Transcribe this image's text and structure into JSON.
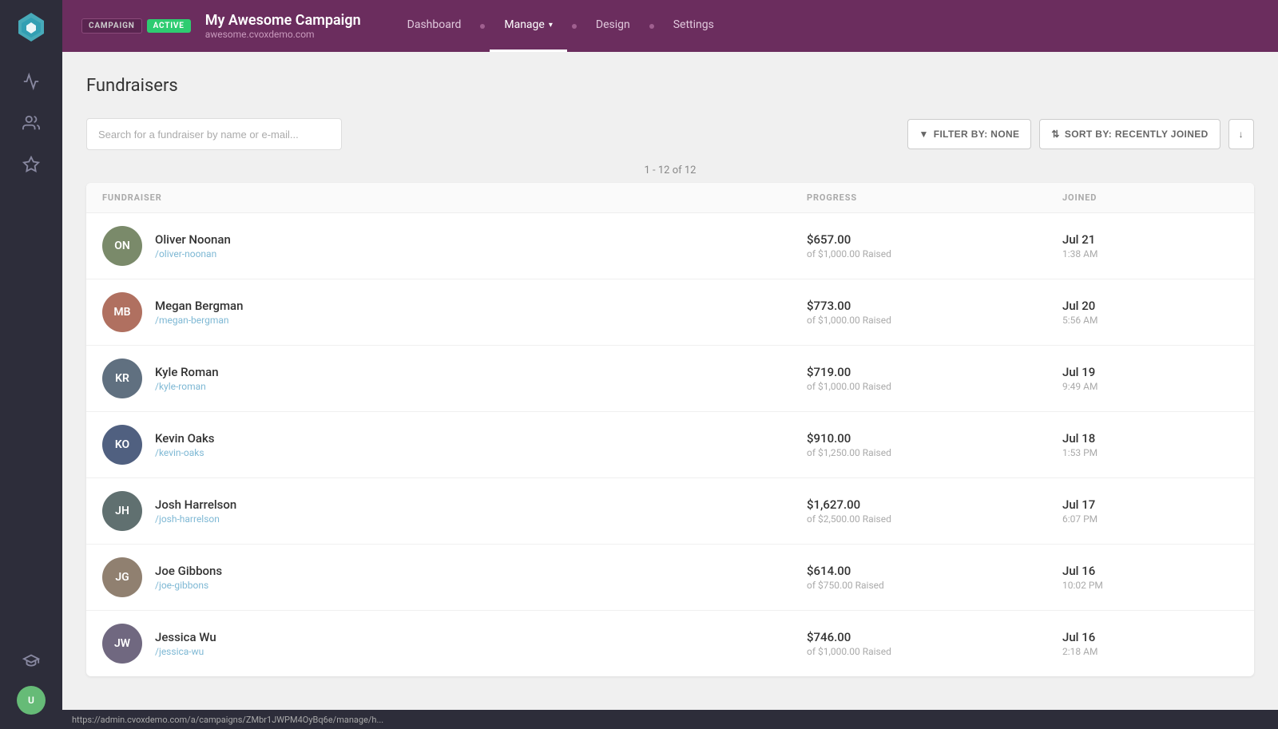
{
  "sidebar": {
    "logo_alt": "Sendoso logo"
  },
  "topbar": {
    "campaign_label": "CAMPAIGN",
    "active_label": "ACTIVE",
    "campaign_name": "My Awesome Campaign",
    "campaign_url": "awesome.cvoxdemo.com",
    "nav": [
      {
        "label": "Dashboard",
        "active": false
      },
      {
        "label": "Manage",
        "active": true,
        "has_chevron": true
      },
      {
        "label": "Design",
        "active": false
      },
      {
        "label": "Settings",
        "active": false
      }
    ]
  },
  "page": {
    "title": "Fundraisers",
    "search_placeholder": "Search for a fundraiser by name or e-mail...",
    "filter_label": "FILTER BY: NONE",
    "sort_label": "SORT BY: RECENTLY JOINED",
    "pagination": "1 - 12 of 12",
    "columns": {
      "fundraiser": "FUNDRAISER",
      "progress": "PROGRESS",
      "joined": "JOINED"
    }
  },
  "fundraisers": [
    {
      "name": "Oliver Noonan",
      "url": "/oliver-noonan",
      "amount": "$657.00",
      "goal": "of $1,000.00 Raised",
      "join_date": "Jul 21",
      "join_time": "1:38 AM",
      "avatar_class": "av-1",
      "initials": "ON"
    },
    {
      "name": "Megan Bergman",
      "url": "/megan-bergman",
      "amount": "$773.00",
      "goal": "of $1,000.00 Raised",
      "join_date": "Jul 20",
      "join_time": "5:56 AM",
      "avatar_class": "av-2",
      "initials": "MB"
    },
    {
      "name": "Kyle Roman",
      "url": "/kyle-roman",
      "amount": "$719.00",
      "goal": "of $1,000.00 Raised",
      "join_date": "Jul 19",
      "join_time": "9:49 AM",
      "avatar_class": "av-3",
      "initials": "KR"
    },
    {
      "name": "Kevin Oaks",
      "url": "/kevin-oaks",
      "amount": "$910.00",
      "goal": "of $1,250.00 Raised",
      "join_date": "Jul 18",
      "join_time": "1:53 PM",
      "avatar_class": "av-4",
      "initials": "KO"
    },
    {
      "name": "Josh Harrelson",
      "url": "/josh-harrelson",
      "amount": "$1,627.00",
      "goal": "of $2,500.00 Raised",
      "join_date": "Jul 17",
      "join_time": "6:07 PM",
      "avatar_class": "av-5",
      "initials": "JH"
    },
    {
      "name": "Joe Gibbons",
      "url": "/joe-gibbons",
      "amount": "$614.00",
      "goal": "of $750.00 Raised",
      "join_date": "Jul 16",
      "join_time": "10:02 PM",
      "avatar_class": "av-6",
      "initials": "JG"
    },
    {
      "name": "Jessica Wu",
      "url": "/jessica-wu",
      "amount": "$746.00",
      "goal": "of $1,000.00 Raised",
      "join_date": "Jul 16",
      "join_time": "2:18 AM",
      "avatar_class": "av-7",
      "initials": "JW"
    }
  ],
  "statusbar": {
    "url": "https://admin.cvoxdemo.com/a/campaigns/ZMbr1JWPM4OyBq6e/manage/h..."
  }
}
